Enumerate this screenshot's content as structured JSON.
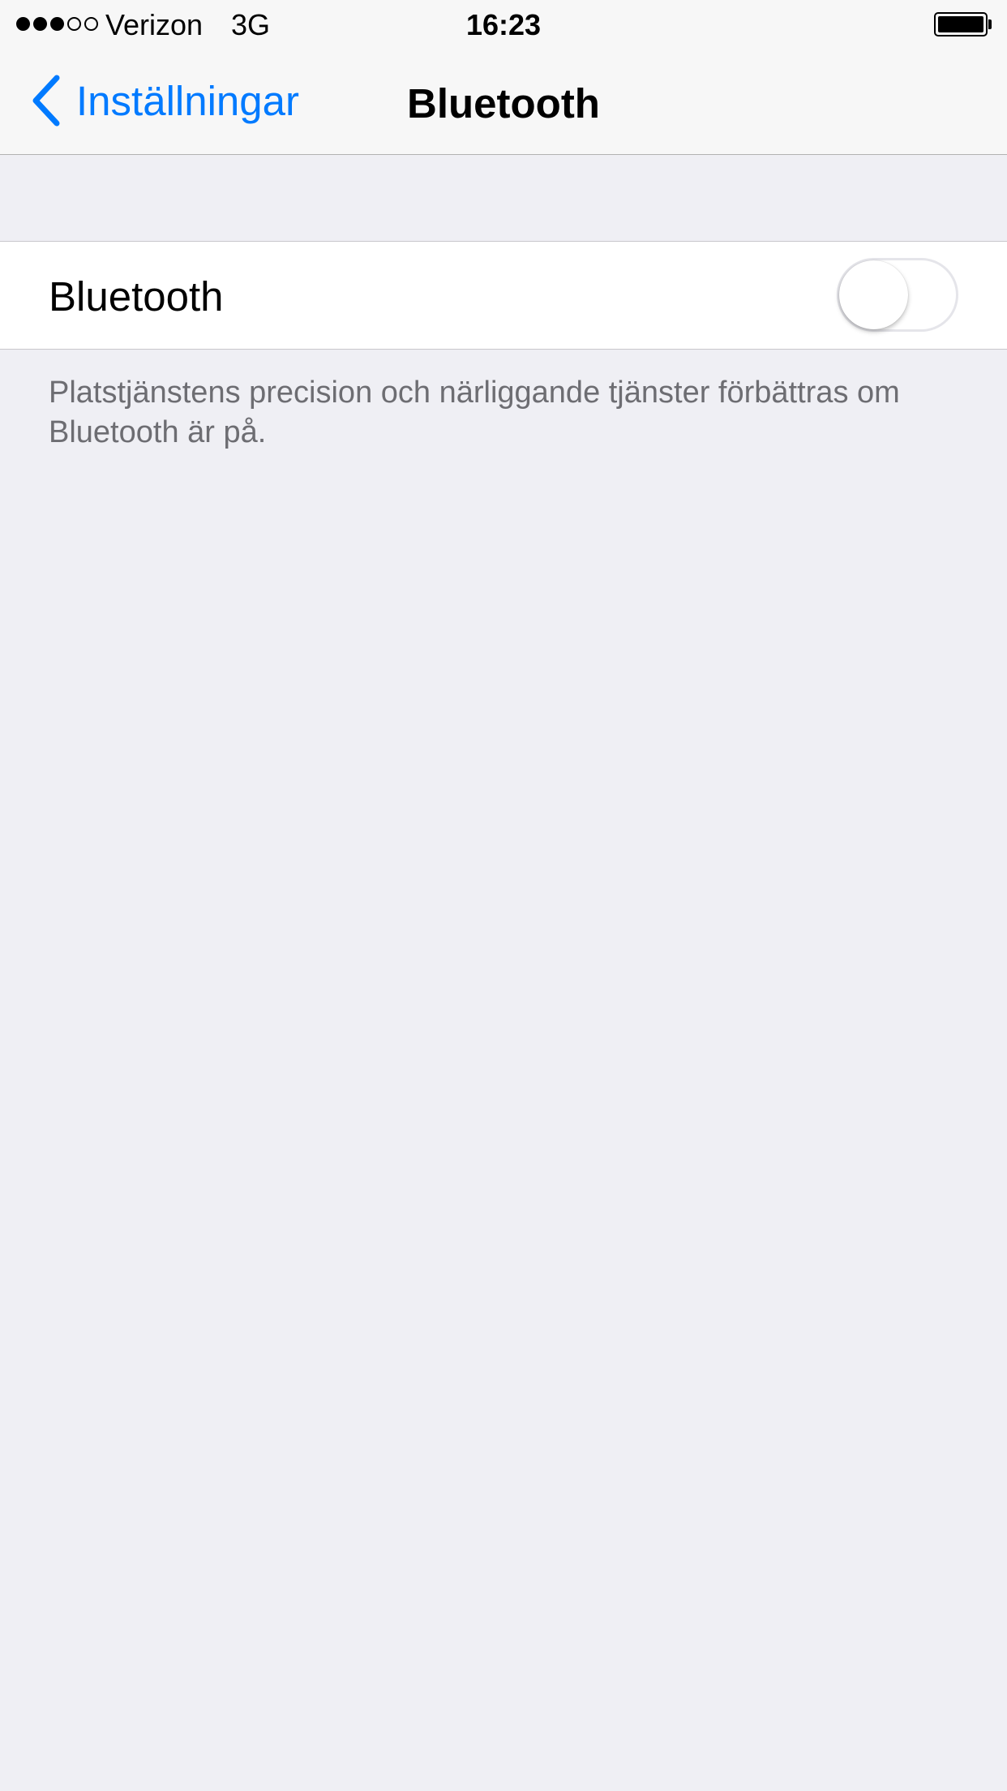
{
  "statusbar": {
    "signal_bars_filled": 3,
    "signal_bars_total": 5,
    "carrier": "Verizon",
    "network": "3G",
    "time": "16:23",
    "battery_level": 1.0
  },
  "navbar": {
    "back_label": "Inställningar",
    "title": "Bluetooth"
  },
  "settings": {
    "bluetooth_label": "Bluetooth",
    "bluetooth_on": false,
    "footer": "Platstjänstens precision och närliggande tjänster förbättras om Bluetooth är på."
  },
  "colors": {
    "accent": "#007aff",
    "background": "#efeff4"
  }
}
